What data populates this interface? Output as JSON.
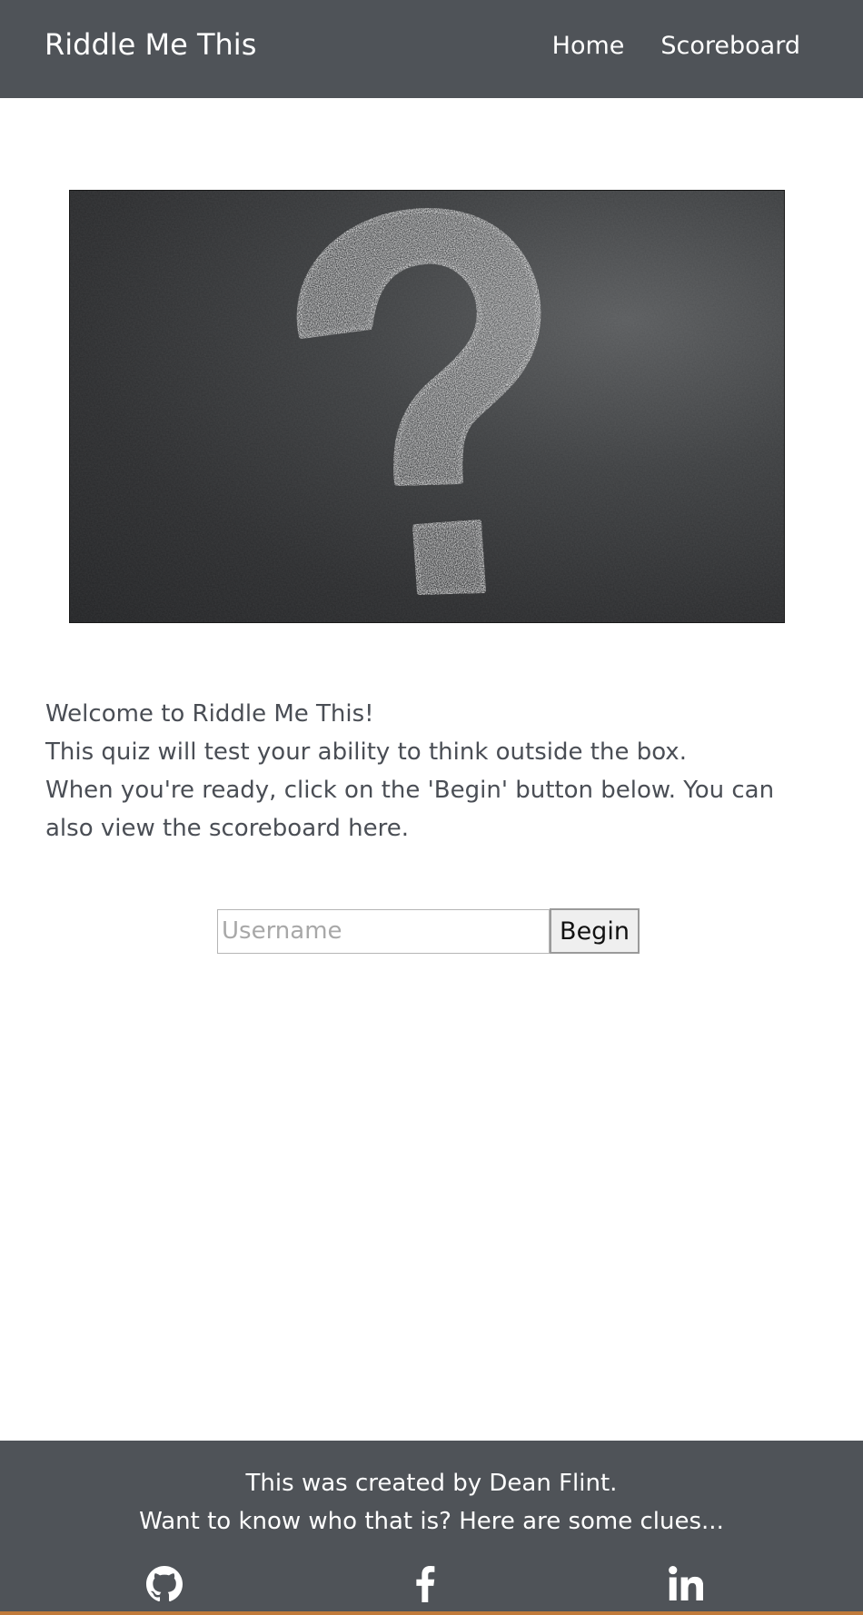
{
  "navbar": {
    "brand": "Riddle Me This",
    "links": [
      {
        "label": "Home"
      },
      {
        "label": "Scoreboard"
      }
    ]
  },
  "hero": {
    "image_alt": "Chalk question mark on a blackboard"
  },
  "welcome": {
    "line1": "Welcome to Riddle Me This!",
    "line2": "This quiz will test your ability to think outside the box.",
    "line3": "When you're ready, click on the 'Begin' button below. You can also view the scoreboard here."
  },
  "form": {
    "username_placeholder": "Username",
    "username_value": "",
    "begin_label": "Begin"
  },
  "footer": {
    "line1": "This was created by Dean Flint.",
    "line2": "Want to know who that is? Here are some clues...",
    "social": [
      {
        "icon": "github-icon"
      },
      {
        "icon": "facebook-icon"
      },
      {
        "icon": "linkedin-icon"
      }
    ]
  },
  "colors": {
    "nav_bg": "#4f5358",
    "footer_bg": "#4f5358",
    "text": "#4a4e55",
    "bottom_strip": "#c07a3a"
  }
}
